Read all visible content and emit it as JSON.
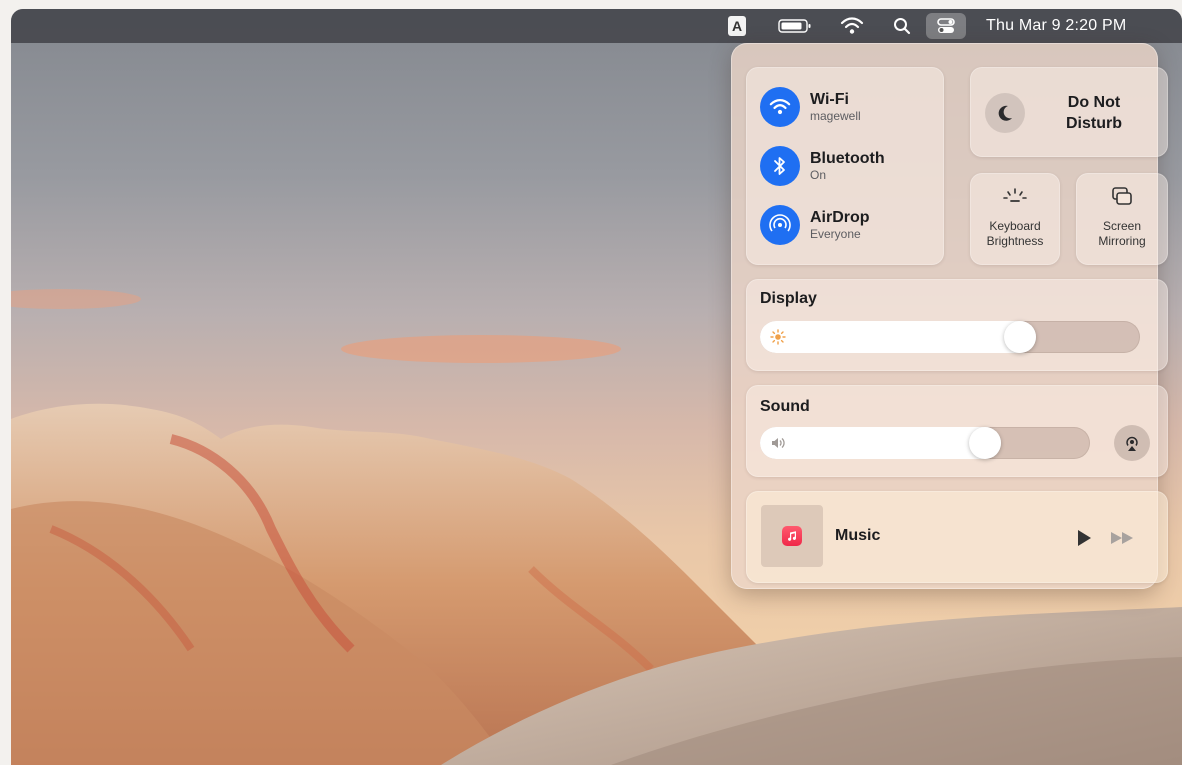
{
  "menubar": {
    "input_source": "A",
    "clock": "Thu Mar 9  2:20 PM",
    "icons": [
      "input-source-icon",
      "battery-icon",
      "wifi-icon",
      "spotlight-search-icon",
      "control-center-icon"
    ]
  },
  "control_center": {
    "wifi": {
      "title": "Wi-Fi",
      "subtitle": "magewell"
    },
    "bluetooth": {
      "title": "Bluetooth",
      "subtitle": "On"
    },
    "airdrop": {
      "title": "AirDrop",
      "subtitle": "Everyone"
    },
    "do_not_disturb": {
      "line1": "Do Not",
      "line2": "Disturb"
    },
    "keyboard_brightness": {
      "line1": "Keyboard",
      "line2": "Brightness"
    },
    "screen_mirroring": {
      "line1": "Screen",
      "line2": "Mirroring"
    },
    "display": {
      "label": "Display",
      "level": 0.7
    },
    "sound": {
      "label": "Sound",
      "level": 0.7
    },
    "music": {
      "title": "Music"
    }
  },
  "colors": {
    "accent": "#1f6ff2",
    "music_red": "#f02849"
  }
}
